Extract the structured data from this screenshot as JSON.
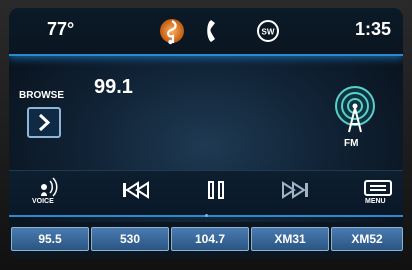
{
  "status_bar": {
    "temperature": "77°",
    "time": "1:35",
    "tabs": [
      {
        "icon": "music-note-icon",
        "active": true
      },
      {
        "icon": "phone-icon",
        "active": false
      },
      {
        "icon": "steering-wheel-icon",
        "label": "SW",
        "active": false
      }
    ]
  },
  "station": {
    "frequency": "99.1",
    "band": "FM"
  },
  "browse": {
    "label": "BROWSE"
  },
  "controls": {
    "voice_label": "VOICE",
    "menu_label": "MENU",
    "icons": [
      "voice-icon",
      "previous-track-icon",
      "pause-icon",
      "next-track-icon",
      "menu-icon"
    ]
  },
  "presets": [
    "95.5",
    "530",
    "104.7",
    "XM31",
    "XM52"
  ],
  "colors": {
    "accent": "#2a8ad0",
    "preset": "#3a6b9e",
    "active_tab": "#e07a20"
  }
}
